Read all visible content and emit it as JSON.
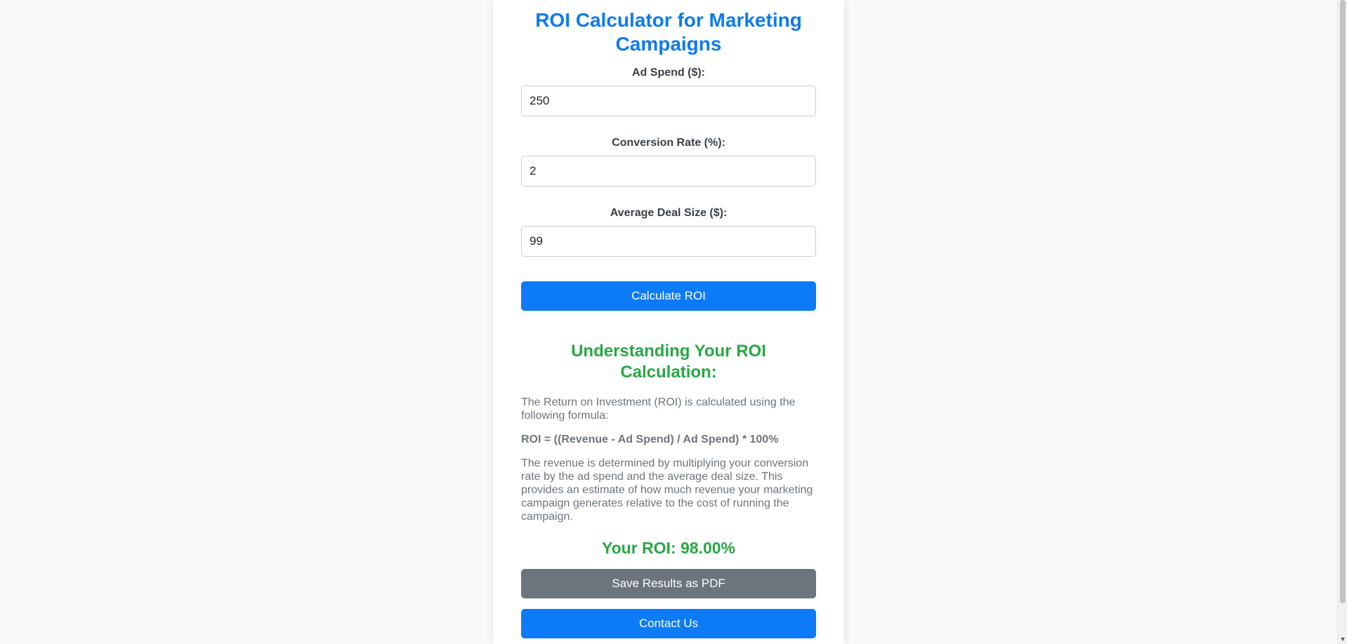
{
  "title": "ROI Calculator for Marketing Campaigns",
  "form": {
    "ad_spend": {
      "label": "Ad Spend ($):",
      "value": "250"
    },
    "conversion_rate": {
      "label": "Conversion Rate (%):",
      "value": "2"
    },
    "deal_size": {
      "label": "Average Deal Size ($):",
      "value": "99"
    },
    "calculate_label": "Calculate ROI"
  },
  "explanation": {
    "heading": "Understanding Your ROI Calculation:",
    "intro": "The Return on Investment (ROI) is calculated using the following formula:",
    "formula": "ROI = ((Revenue - Ad Spend) / Ad Spend) * 100%",
    "details": "The revenue is determined by multiplying your conversion rate by the ad spend and the average deal size. This provides an estimate of how much revenue your marketing campaign generates relative to the cost of running the campaign."
  },
  "result": {
    "text": "Your ROI: 98.00%"
  },
  "actions": {
    "save_pdf_label": "Save Results as PDF",
    "contact_label": "Contact Us"
  },
  "colors": {
    "title": "#0d7bf0",
    "primary_button": "#0d7bf7",
    "secondary_button": "#6c747c",
    "success": "#28a745",
    "muted_text": "#6c757d"
  },
  "icons": {
    "scroll_down": "scroll-down-arrow-icon"
  }
}
